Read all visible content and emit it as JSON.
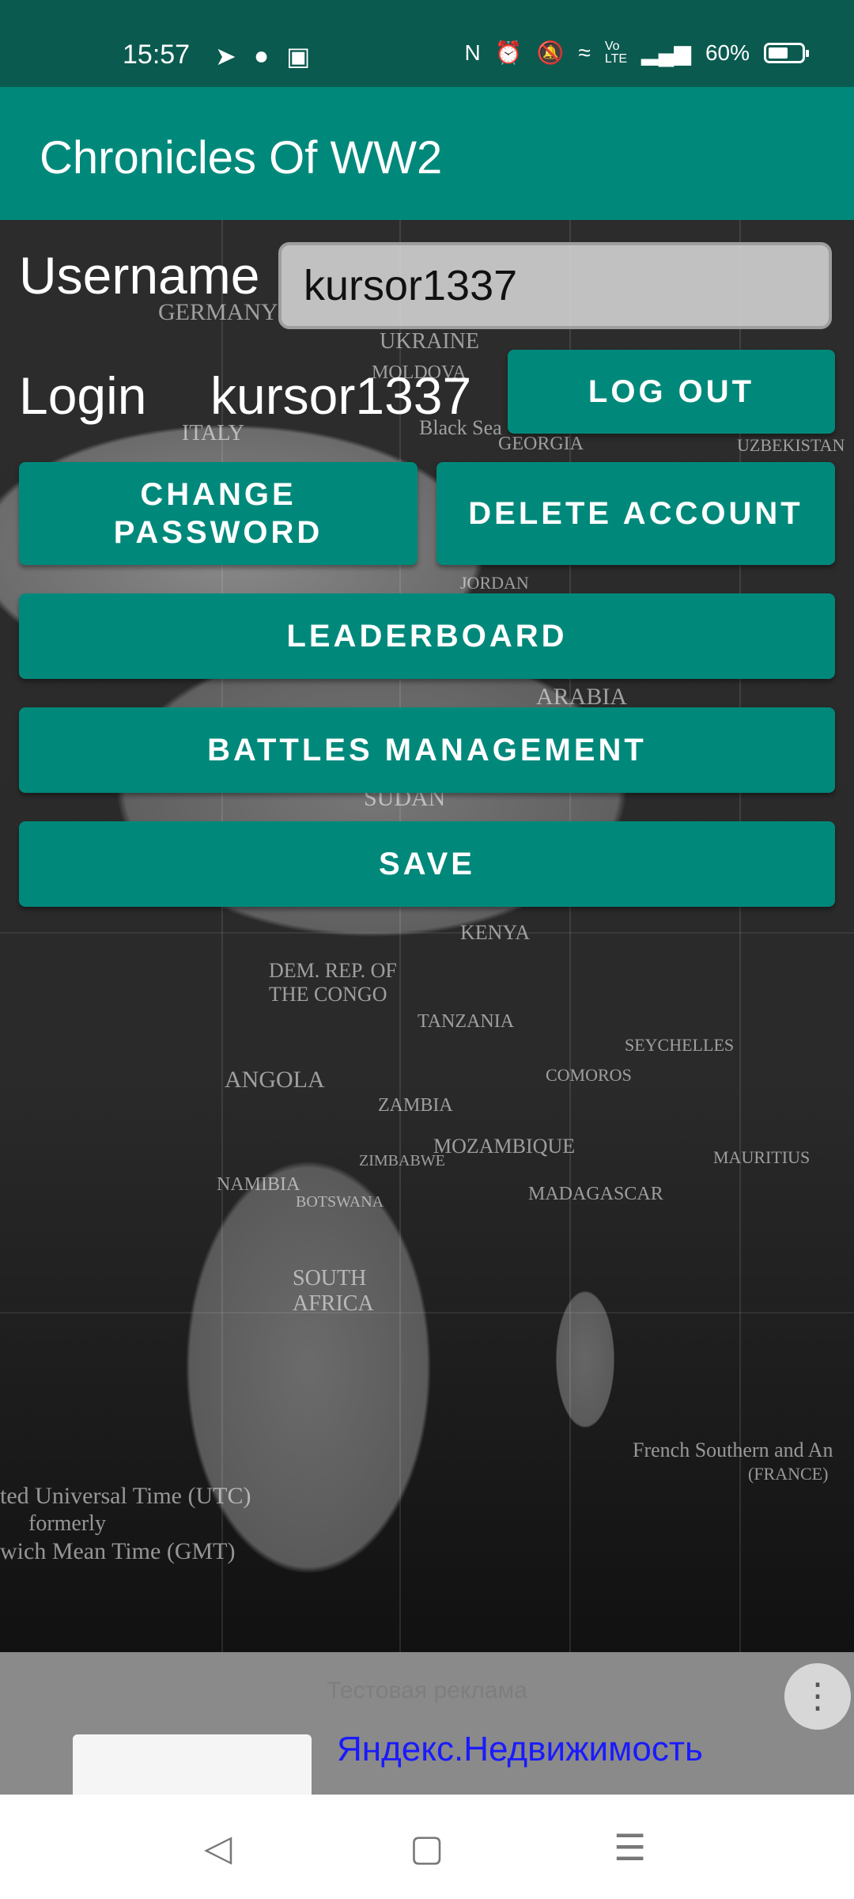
{
  "status_bar": {
    "time": "15:57",
    "left_icons": [
      "telegram-icon",
      "reddit-icon",
      "instagram-icon"
    ],
    "right_icons": [
      "nfc-icon",
      "alarm-icon",
      "mute-icon",
      "wifi-icon",
      "volte-icon",
      "signal-icon"
    ],
    "battery_text": "60%",
    "battery_level": 0.6
  },
  "app_bar": {
    "title": "Chronicles Of WW2"
  },
  "form": {
    "username_label": "Username",
    "username_value": "kursor1337",
    "login_label": "Login",
    "login_value": "kursor1337"
  },
  "buttons": {
    "log_out": "LOG OUT",
    "change_password": "CHANGE PASSWORD",
    "delete_account": "DELETE ACCOUNT",
    "leaderboard": "LEADERBOARD",
    "battles_management": "BATTLES MANAGEMENT",
    "save": "SAVE"
  },
  "map_labels": {
    "germany": "GERMANY",
    "ukraine": "UKRAINE",
    "moldova": "MOLDOVA",
    "italy": "ITALY",
    "black_sea": "Black Sea",
    "georgia": "GEORGIA",
    "uzbekistan": "UZBEKISTAN",
    "jordan": "JORDAN",
    "arabia": "ARABIA",
    "sudan": "SUDAN",
    "kenya": "KENYA",
    "dem_rep_congo": "DEM. REP. OF THE CONGO",
    "tanzania": "TANZANIA",
    "angola": "ANGOLA",
    "zambia": "ZAMBIA",
    "mozambique": "MOZAMBIQUE",
    "madagascar": "MADAGASCAR",
    "namibia": "NAMIBIA",
    "botswana": "BOTSWANA",
    "zimbabwe": "ZIMBABWE",
    "south_africa": "SOUTH AFRICA",
    "seychelles": "SEYCHELLES",
    "comoros": "COMOROS",
    "mauritius": "MAURITIUS",
    "utc": "ted Universal Time (UTC)",
    "formerly": "formerly",
    "gmt": "wich Mean Time (GMT)",
    "french_southern": "French Southern and An",
    "france": "(FRANCE)"
  },
  "ad": {
    "label": "Тестовая реклама",
    "title": "Яндекс.Недвижимость",
    "menu_icon": "more-vert-icon"
  },
  "nav_bar": {
    "back_icon": "back-triangle-icon",
    "home_icon": "home-square-icon",
    "menu_icon": "menu-lines-icon"
  }
}
